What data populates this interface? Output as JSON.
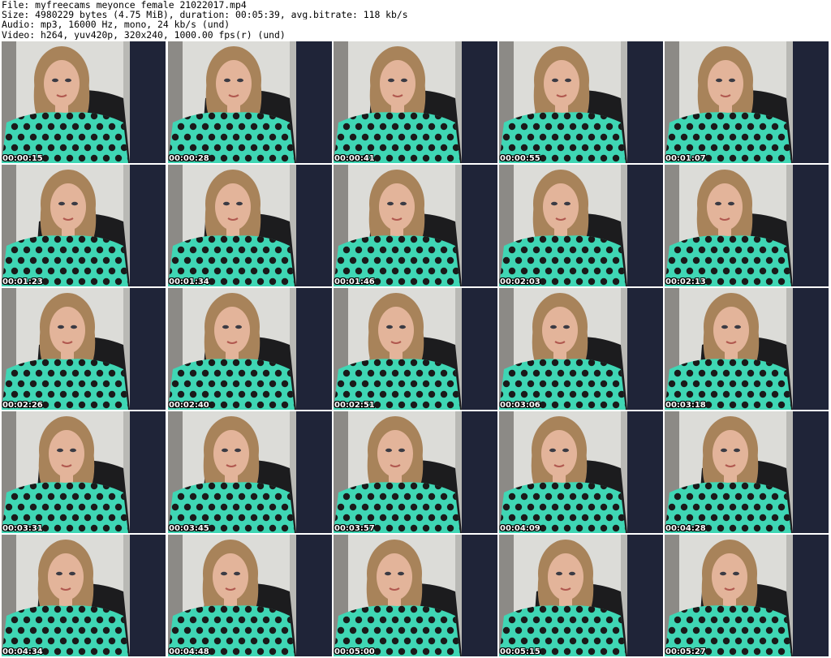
{
  "header": {
    "line1": "File: myfreecams_meyonce_female_21022017.mp4",
    "line2": "Size: 4980229 bytes (4.75 MiB), duration: 00:05:39, avg.bitrate: 118 kb/s",
    "line3": "Audio: mp3, 16000 Hz, mono, 24 kb/s (und)",
    "line4": "Video: h264, yuv420p, 320x240, 1000.00 fps(r) (und)"
  },
  "thumbnails": [
    "00:00:15",
    "00:00:28",
    "00:00:41",
    "00:00:55",
    "00:01:07",
    "00:01:23",
    "00:01:34",
    "00:01:46",
    "00:02:03",
    "00:02:13",
    "00:02:26",
    "00:02:40",
    "00:02:51",
    "00:03:06",
    "00:03:18",
    "00:03:31",
    "00:03:45",
    "00:03:57",
    "00:04:09",
    "00:04:28",
    "00:04:34",
    "00:04:48",
    "00:05:00",
    "00:05:15",
    "00:05:27"
  ],
  "colors": {
    "wall": "#dcdcd8",
    "chair": "#1c1c1e",
    "shirt": "#3fd6b4",
    "dots": "#1a1a1a",
    "hair": "#a8835a",
    "skin": "#e3b49a",
    "jacket": "#1f2438"
  }
}
